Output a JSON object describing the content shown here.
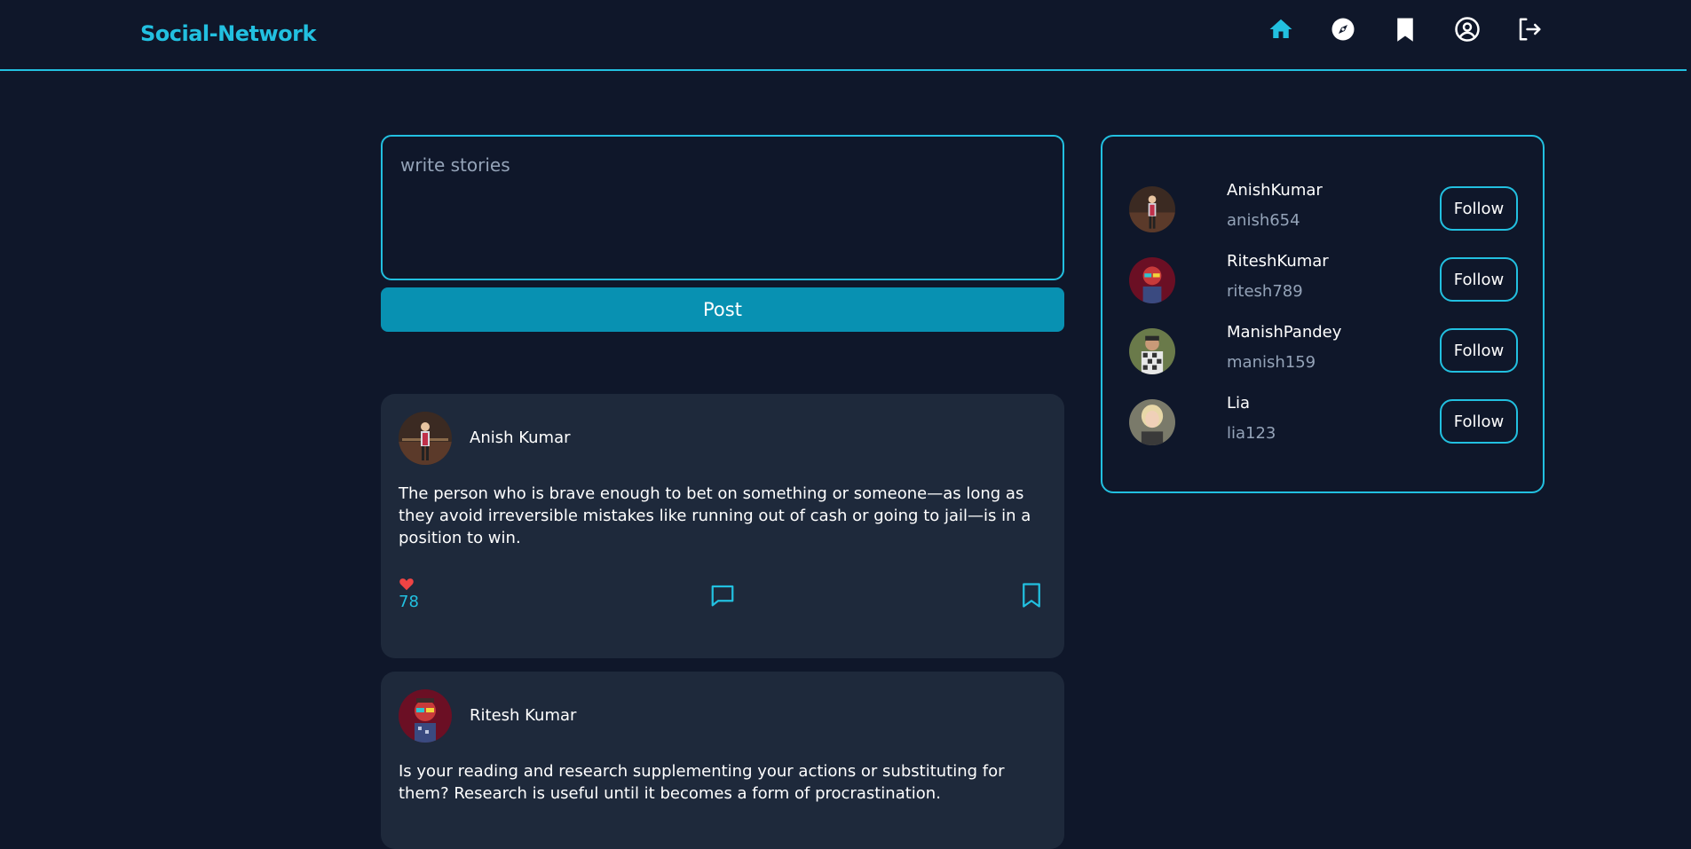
{
  "brand": "Social-Network",
  "nav": [
    {
      "name": "home-icon",
      "active": true
    },
    {
      "name": "explore-icon",
      "active": false
    },
    {
      "name": "bookmark-icon",
      "active": false
    },
    {
      "name": "profile-icon",
      "active": false
    },
    {
      "name": "logout-icon",
      "active": false
    }
  ],
  "colors": {
    "background": "#0f172a",
    "card": "#1e293b",
    "accent": "#22c0e0",
    "button": "#0891b2",
    "like": "#ef4444",
    "muted": "#94a3b8"
  },
  "composer": {
    "placeholder": "write stories",
    "post_label": "Post"
  },
  "posts": [
    {
      "author": "Anish  Kumar",
      "text": "The person who is brave enough to bet on something or someone—as long as they avoid irreversible mistakes like running out of cash or going to jail—is in a position to win.",
      "likes": "78"
    },
    {
      "author": "Ritesh  Kumar",
      "text": "Is your reading and research supplementing your actions or substituting for them? Research is useful until it becomes a form of procrastination."
    }
  ],
  "suggestions": [
    {
      "name": "AnishKumar",
      "handle": "anish654",
      "follow": "Follow"
    },
    {
      "name": "RiteshKumar",
      "handle": "ritesh789",
      "follow": "Follow"
    },
    {
      "name": "ManishPandey",
      "handle": "manish159",
      "follow": "Follow"
    },
    {
      "name": "Lia",
      "handle": "lia123",
      "follow": "Follow"
    }
  ]
}
